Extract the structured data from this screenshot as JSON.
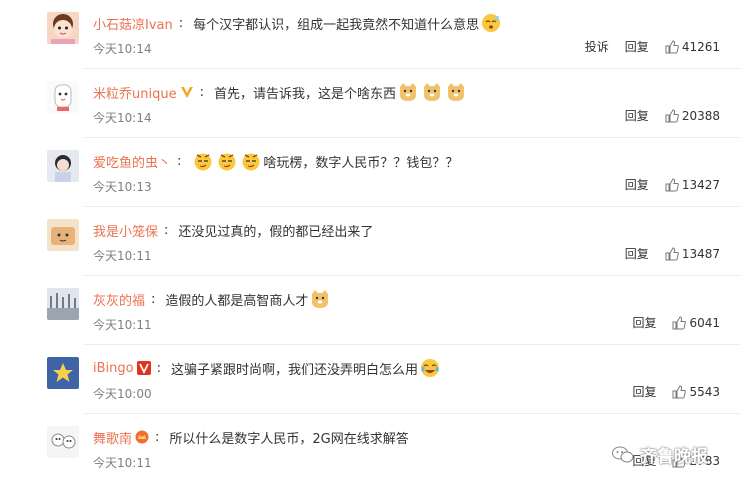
{
  "comments": [
    {
      "user": "小石菇凉Ivan",
      "text": "每个汉字都认识，组成一起我竟然不知道什么意思",
      "time": "今天10:14",
      "report": "投诉",
      "reply": "回复",
      "likes": "41261"
    },
    {
      "user": "米粒乔unique",
      "text": "首先，请告诉我，这是个啥东西",
      "time": "今天10:14",
      "reply": "回复",
      "likes": "20388"
    },
    {
      "user": "爱吃鱼的虫丶",
      "text": "啥玩楞，数字人民币？？钱包？？",
      "time": "今天10:13",
      "reply": "回复",
      "likes": "13427"
    },
    {
      "user": "我是小笼保",
      "text": "还没见过真的，假的都已经出来了",
      "time": "今天10:11",
      "reply": "回复",
      "likes": "13487"
    },
    {
      "user": "灰灰的福",
      "text": "造假的人都是高智商人才",
      "time": "今天10:11",
      "reply": "回复",
      "likes": "6041"
    },
    {
      "user": "iBingo",
      "text": "这骗子紧跟时尚啊，我们还没弄明白怎么用",
      "time": "今天10:00",
      "reply": "回复",
      "likes": "5543"
    },
    {
      "user": "舞歌南",
      "text": "所以什么是数字人民币，2G网在线求解答",
      "time": "今天10:11",
      "reply": "回复",
      "likes": "2783"
    }
  ],
  "watermark": "齐鲁晚报",
  "colors": {
    "username": "#eb7350",
    "time": "#808080",
    "vip_badge": "#f5a623",
    "red_badge": "#e0321e"
  }
}
